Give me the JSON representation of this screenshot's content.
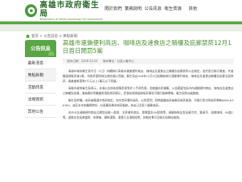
{
  "header": {
    "logo_zh": "高雄市政府衛生局",
    "logo_en": "Department of Health Kaohsiung City Government",
    "nav": [
      "開於我們",
      "業務說明",
      "公告訊息",
      "衛生資源",
      "其他"
    ]
  },
  "breadcrumb": {
    "text": "首頁 > 公告訊息 > 焦點新聞"
  },
  "sidebar": {
    "title": "公告訊息",
    "items": [
      "最新消息",
      "焦點新聞",
      "活動訊息",
      "法規資訊",
      "其他公告"
    ]
  },
  "article": {
    "title": "高雄市連鎖便利商店、咖啡店及速食店之騎樓及庇廊禁菸12月1日首日開罰5案",
    "meta": [
      "發布日期：2019-12-01",
      "發布單位：社區公衛中心"
    ],
    "paragraphs": [
      "高雄市政府衛生局今日（1日）持續執行高雄市連鎖便利商店、咖啡店及速食店之騎樓及庇廊禁菸公告規定，並於首日執行稽查，共查獲違規吸菸者5案，均依菸害防制法規定處以罰鍰。衛生局自108年12月1日起開始執行連鎖便利商店、咖啡店及速食店騎樓及庇廊全面禁菸，違者處新臺幣2千元以上1萬元以下罰鍰。",
      "高雄市政府衛生局表示，本項公告係為保障民眾免於二手菸危害，並維護市民健康，公告範圍包括市內連鎖便利商店、咖啡店及速食店之騎樓及庇廊，業者應於明顯處所張貼禁菸標示，民眾若發現違規吸菸情形可撥打檢舉專線，衛生局將派員稽查。",
      "衛生局呼籲，吸菸者應遵守禁菸規定，勿在禁菸場所吸菸，以免受罰；同時鼓勵吸菸者善用戒菸資源，可撥打免付費戒菸專線0800-636363，或至本市各醫療院所、社區藥局尋求戒菸服務，為自己及家人健康戒菸。",
      "本市公告連鎖便利商店品牌包括統一超商、全家便利商店、萊爾富及OK超商等，連鎖咖啡店包括星巴克、路易莎、伯朗咖啡、85度C等，速食店包括麥當勞、肯德基、摩斯漢堡、漢堡王及頂呱呱等，詳細名單可至衛生局網站查詢。"
    ]
  },
  "colors": {
    "brand_green": "#5aa544",
    "title_green": "#4a8f2f"
  }
}
